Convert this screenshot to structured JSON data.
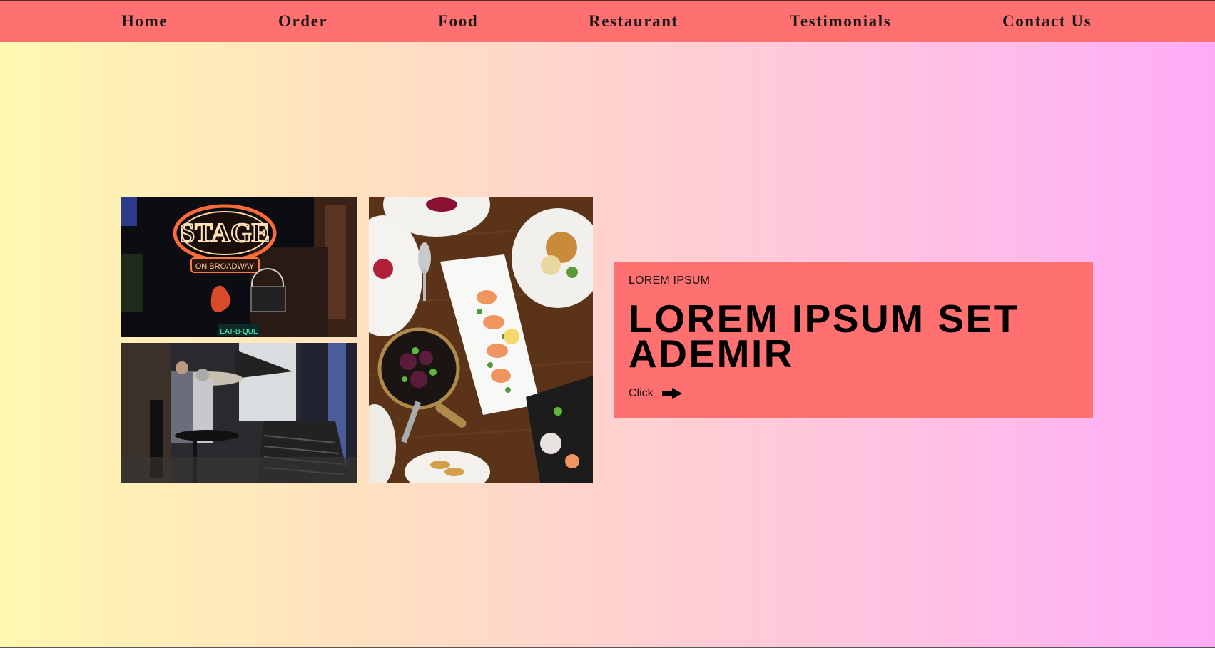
{
  "nav": {
    "items": [
      {
        "label": "Home"
      },
      {
        "label": "Order"
      },
      {
        "label": "Food"
      },
      {
        "label": "Restaurant"
      },
      {
        "label": "Testimonials"
      },
      {
        "label": "Contact Us"
      }
    ]
  },
  "images": {
    "neon_sign": {
      "alt": "neon-sign-photo"
    },
    "street": {
      "alt": "street-cafe-photo"
    },
    "dishes": {
      "alt": "food-dishes-photo"
    }
  },
  "hero": {
    "eyebrow": "LOREM IPSUM",
    "title": "LOREM IPSUM SET ADEMIR",
    "cta_label": "Click",
    "cta_icon": "arrow-right-icon"
  },
  "colors": {
    "accent": "#ff7070",
    "gradient_start": "#fff8b0",
    "gradient_end": "#ffacf8"
  }
}
